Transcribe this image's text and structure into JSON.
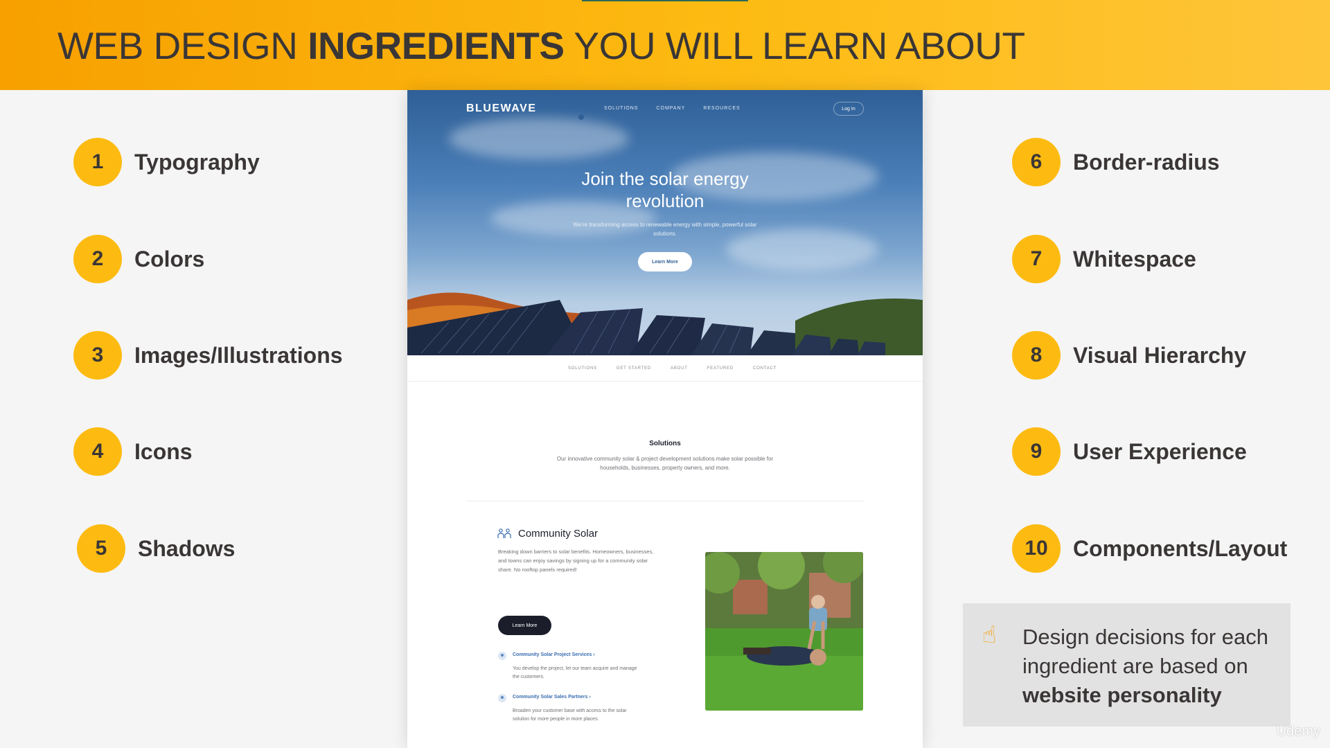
{
  "header": {
    "title_part1": "WEB DESIGN ",
    "title_bold": "INGREDIENTS",
    "title_part2": " YOU WILL LEARN ABOUT",
    "colors": {
      "gradient_start": "#f7a000",
      "gradient_end": "#ffc53a",
      "text": "#3a3636"
    }
  },
  "ingredients_left": [
    {
      "number": "1",
      "label": "Typography"
    },
    {
      "number": "2",
      "label": "Colors"
    },
    {
      "number": "3",
      "label": "Images/Illustrations"
    },
    {
      "number": "4",
      "label": "Icons"
    },
    {
      "number": "5",
      "label": "Shadows"
    }
  ],
  "ingredients_right": [
    {
      "number": "6",
      "label": "Border-radius"
    },
    {
      "number": "7",
      "label": "Whitespace"
    },
    {
      "number": "8",
      "label": "Visual Hierarchy"
    },
    {
      "number": "9",
      "label": "User Experience"
    },
    {
      "number": "10",
      "label": "Components/Layout"
    }
  ],
  "note": {
    "icon": "pointing-up-hand-icon",
    "text": "Design decisions for each ingredient are based on",
    "bold": "website personality"
  },
  "watermark": "Udemy",
  "site": {
    "logo": "BLUEWAVE",
    "nav": [
      "SOLUTIONS",
      "COMPANY",
      "RESOURCES"
    ],
    "login": "Log In",
    "hero_title": "Join the solar energy revolution",
    "hero_subtitle": "We're transforming access to renewable energy with simple, powerful solar solutions.",
    "hero_button": "Learn More",
    "subnav": [
      "SOLUTIONS",
      "GET STARTED",
      "ABOUT",
      "FEATURED",
      "CONTACT"
    ],
    "solutions_title": "Solutions",
    "solutions_desc": "Our innovative community solar & project development solutions make solar possible for households, businesses, property owners, and more.",
    "community_title": "Community Solar",
    "community_desc": "Breaking down barriers to solar benefits. Homeowners, businesses, and towns can enjoy savings by signing up for a community solar share. No rooftop panels required!",
    "community_button": "Learn More",
    "services": [
      {
        "title": "Community Solar Project Services ›",
        "desc": "You develop the project, let our team acquire and manage the customers."
      },
      {
        "title": "Community Solar Sales Partners ›",
        "desc": "Broaden your customer base with access to the solar solution for more people in more places."
      }
    ],
    "colors": {
      "brand_blue": "#2f5f96",
      "dark": "#1b1e2a",
      "link": "#3a6db0"
    }
  }
}
